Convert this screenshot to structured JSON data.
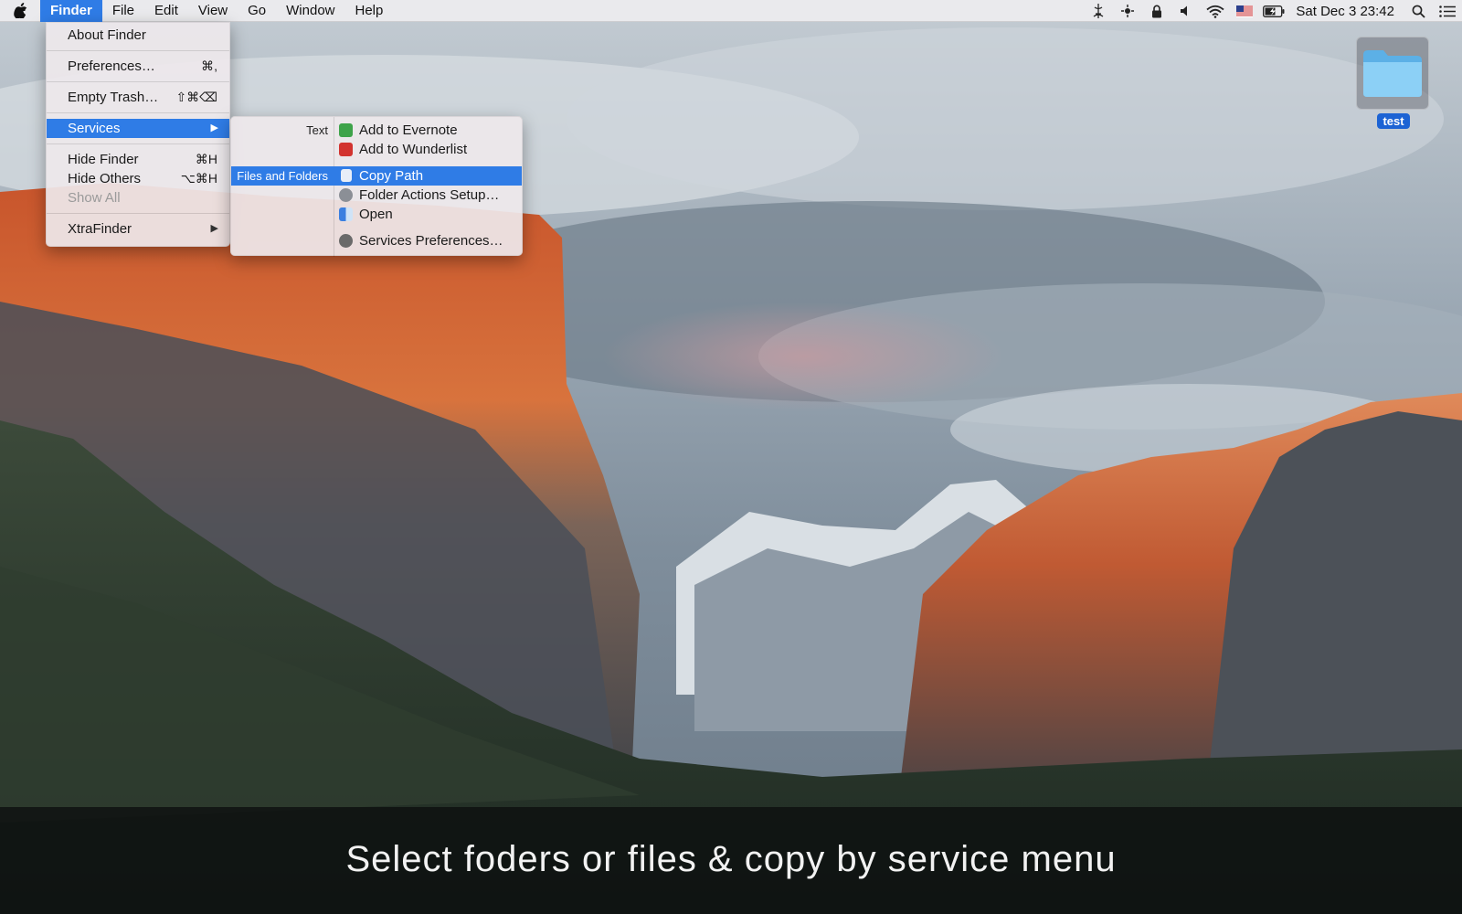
{
  "menubar": {
    "apple_icon": "apple-logo-icon",
    "items": [
      "Finder",
      "File",
      "Edit",
      "View",
      "Go",
      "Window",
      "Help"
    ],
    "active": "Finder",
    "status_icons": [
      "ancient-sign-icon",
      "brightness-icon",
      "lock-icon",
      "volume-icon",
      "wifi-icon",
      "us-flag-icon",
      "battery-charging-icon"
    ],
    "clock": "Sat Dec 3  23:42",
    "search_icon": "spotlight-search-icon",
    "list_icon": "notification-center-icon"
  },
  "finder_menu": {
    "about": "About Finder",
    "preferences": "Preferences…",
    "preferences_shortcut": "⌘,",
    "empty_trash": "Empty Trash…",
    "empty_trash_shortcut": "⇧⌘⌫",
    "services": "Services",
    "hide_finder": "Hide Finder",
    "hide_finder_shortcut": "⌘H",
    "hide_others": "Hide Others",
    "hide_others_shortcut": "⌥⌘H",
    "show_all": "Show All",
    "xtrafinder": "XtraFinder",
    "submenu_arrow": "▶"
  },
  "services_menu": {
    "category_text": "Text",
    "category_files": "Files and Folders",
    "add_evernote": "Add to Evernote",
    "add_wunderlist": "Add to Wunderlist",
    "copy_path": "Copy Path",
    "folder_actions": "Folder Actions Setup…",
    "open": "Open",
    "services_prefs": "Services Preferences…"
  },
  "desktop": {
    "folder_label": "test",
    "folder_icon": "folder-icon"
  },
  "caption": "Select foders or files & copy by service menu",
  "colors": {
    "highlight": "#2f7ce6",
    "folder_label": "#1c63d4"
  }
}
